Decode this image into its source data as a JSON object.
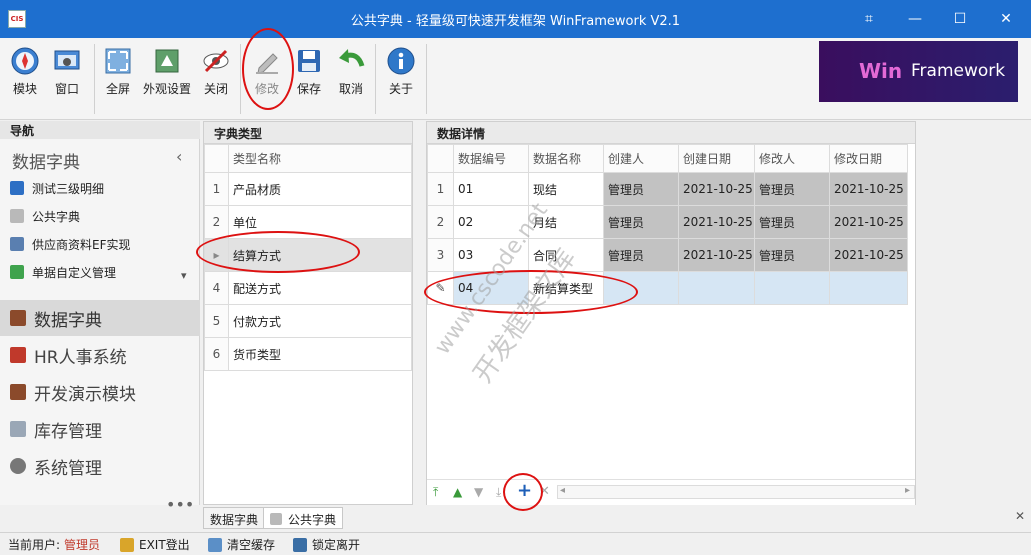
{
  "window": {
    "title": "公共字典 - 轻量级可快速开发框架 WinFramework V2.1",
    "app_icon_text": "CIS",
    "header_icons": {
      "settings": "⌗",
      "minimize": "—",
      "maximize": "☐",
      "close": "✕"
    }
  },
  "ribbon": {
    "buttons": [
      {
        "label": "模块",
        "icon": "compass-icon"
      },
      {
        "label": "窗口",
        "icon": "window-icon"
      },
      {
        "label": "全屏",
        "icon": "fullscreen-icon"
      },
      {
        "label": "外观设置",
        "icon": "appearance-icon"
      },
      {
        "label": "关闭",
        "icon": "close-eye-icon"
      },
      {
        "label": "修改",
        "icon": "edit-icon"
      },
      {
        "label": "保存",
        "icon": "save-icon"
      },
      {
        "label": "取消",
        "icon": "undo-icon"
      },
      {
        "label": "关于",
        "icon": "info-icon"
      }
    ],
    "logo": {
      "part1": "Win",
      "part2": "Framework"
    }
  },
  "nav": {
    "header": "导航",
    "section_title": "数据字典",
    "collapse_glyph": "‹",
    "items": [
      {
        "label": "测试三级明细",
        "color": "#2d6fc4"
      },
      {
        "label": "公共字典",
        "color": "#b9b9b9"
      },
      {
        "label": "供应商资料EF实现",
        "color": "#5a7fb0"
      },
      {
        "label": "单据自定义管理",
        "color": "#3fa34d"
      }
    ],
    "scroll_glyph": "▾",
    "groups": [
      {
        "label": "数据字典",
        "color": "#8b4a2b",
        "active": true
      },
      {
        "label": "HR人事系统",
        "color": "#c0392b"
      },
      {
        "label": "开发演示模块",
        "color": "#8b4a2b"
      },
      {
        "label": "库存管理",
        "color": "#9aa7b6"
      },
      {
        "label": "系统管理",
        "color": "#777777"
      }
    ],
    "more": "•••"
  },
  "dict_types": {
    "title": "字典类型",
    "column": "类型名称",
    "rows": [
      {
        "n": "1",
        "name": "产品材质"
      },
      {
        "n": "2",
        "name": "单位"
      },
      {
        "n": "▸",
        "name": "结算方式"
      },
      {
        "n": "4",
        "name": "配送方式"
      },
      {
        "n": "5",
        "name": "付款方式"
      },
      {
        "n": "6",
        "name": "货币类型"
      }
    ]
  },
  "details": {
    "title": "数据详情",
    "columns": [
      "数据编号",
      "数据名称",
      "创建人",
      "创建日期",
      "修改人",
      "修改日期"
    ],
    "rows": [
      {
        "n": "1",
        "code": "01",
        "name": "现结",
        "creator": "管理员",
        "created": "2021-10-25",
        "modifier": "管理员",
        "modified": "2021-10-25"
      },
      {
        "n": "2",
        "code": "02",
        "name": "月结",
        "creator": "管理员",
        "created": "2021-10-25",
        "modifier": "管理员",
        "modified": "2021-10-25"
      },
      {
        "n": "3",
        "code": "03",
        "name": "合同",
        "creator": "管理员",
        "created": "2021-10-25",
        "modifier": "管理员",
        "modified": "2021-10-25"
      }
    ],
    "new_row": {
      "n": "✎",
      "code": "04",
      "name": "新结算类型"
    },
    "toolbar": {
      "first": "⤒",
      "prev": "▲",
      "next": "▼",
      "last": "⤓",
      "add": "+",
      "delete": "✕",
      "scroll_left": "◂",
      "scroll_right": "▸"
    }
  },
  "tabs": {
    "items": [
      "数据字典",
      "公共字典"
    ],
    "close": "✕"
  },
  "status": {
    "user_label": "当前用户:",
    "user": "管理员",
    "exit": "EXIT登出",
    "clear_cache": "清空缓存",
    "lock": "锁定离开"
  },
  "watermark": {
    "line1": "www.cscode.net",
    "line2": "开发框架文库"
  },
  "colors": {
    "accent": "#1e6fcf",
    "highlight_circle": "#dd1111",
    "readonly_cell": "#c2c2c2",
    "new_row": "#d6e6f4"
  }
}
